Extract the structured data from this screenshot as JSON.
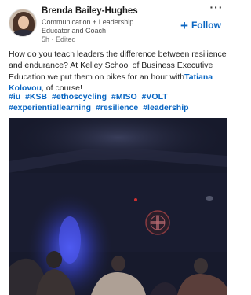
{
  "author": {
    "name": "Brenda Bailey-Hughes",
    "headline": "Communication + Leadership Educator and Coach",
    "meta": "5h · Edited"
  },
  "actions": {
    "more_icon": "more-horizontal-icon",
    "more_label": "···",
    "follow_icon": "plus-icon",
    "follow_label": "Follow"
  },
  "post": {
    "text_before_mention": "How do you teach leaders the difference between resilience and endurance?  At Kelley School of Business Executive Education we put them on bikes for an hour with",
    "mention": "Tatiana Kolovou",
    "text_after_mention": ", of course!",
    "hashtags": [
      "#iu",
      "#KSB",
      "#ethoscycling",
      "#MISO",
      "#VOLT",
      "#experientiallearning",
      "#resilience",
      "#leadership"
    ]
  },
  "media": {
    "type": "photo",
    "description_icon": "indoor-cycling-class-photo"
  },
  "colors": {
    "link": "#0a66c2",
    "text": "#1d1d1d",
    "muted": "#6b6b6b"
  }
}
